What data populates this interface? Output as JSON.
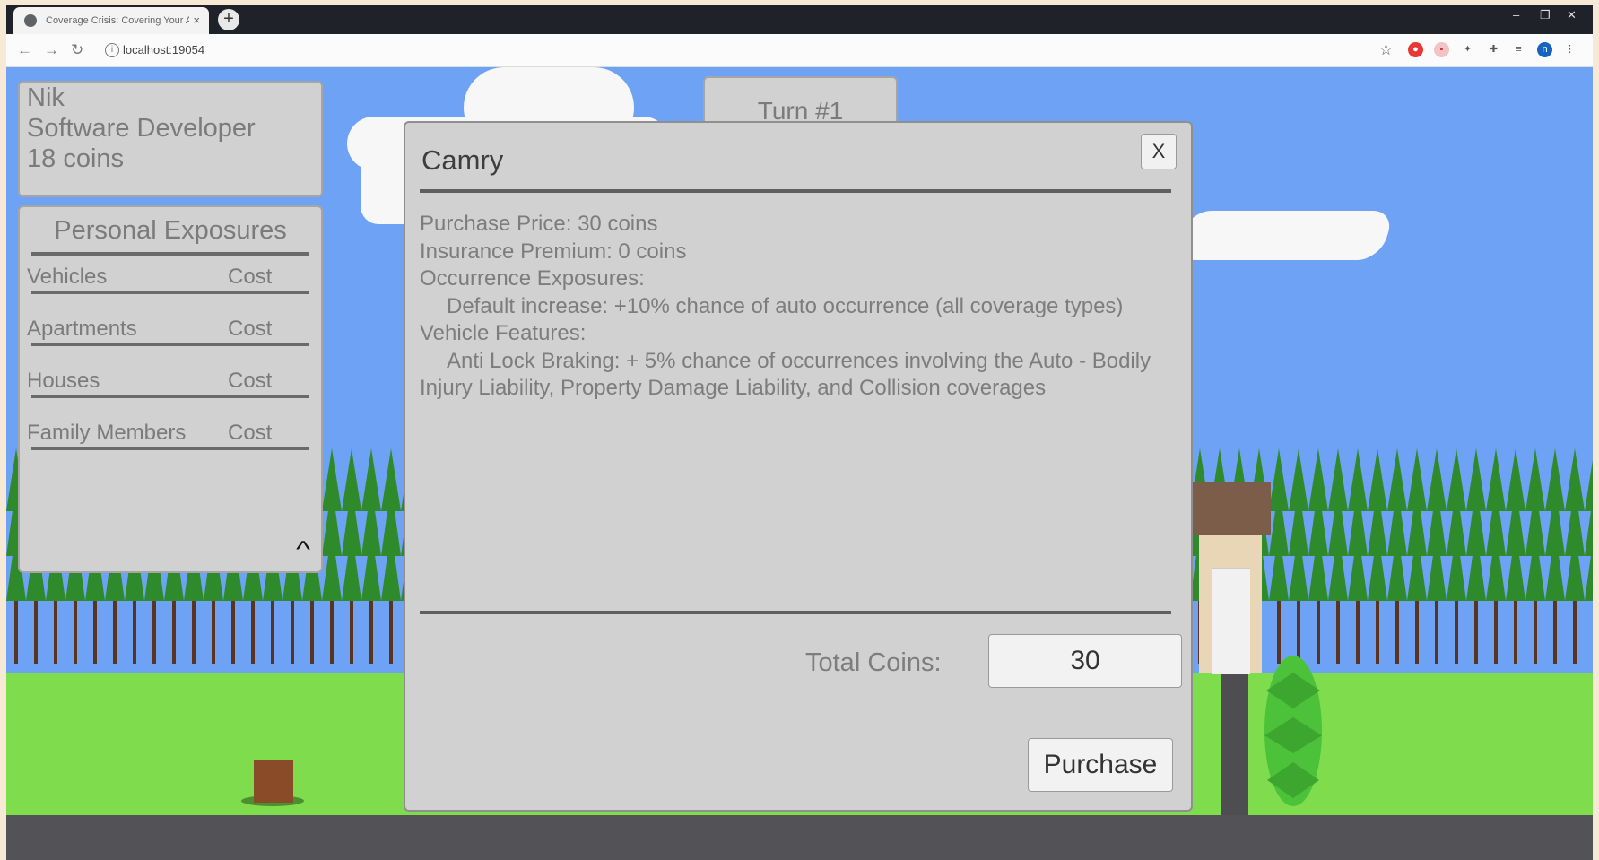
{
  "browser": {
    "tab_title": "Coverage Crisis: Covering Your A",
    "tab_close": "×",
    "new_tab": "+",
    "url": "localhost:19054",
    "window_controls": [
      "‒",
      "❐",
      "✕"
    ]
  },
  "player": {
    "name": "Nik",
    "occupation": "Software Developer",
    "coins": "18 coins"
  },
  "exposures": {
    "title": "Personal Exposures",
    "rows": [
      {
        "label": "Vehicles",
        "cost": "Cost"
      },
      {
        "label": "Apartments",
        "cost": "Cost"
      },
      {
        "label": "Houses",
        "cost": "Cost"
      },
      {
        "label": "Family Members",
        "cost": "Cost"
      }
    ],
    "collapse_icon": "^"
  },
  "turn": {
    "label": "Turn #1"
  },
  "modal": {
    "title": "Camry",
    "close": "X",
    "lines": [
      "Purchase Price: 30 coins",
      "Insurance Premium: 0 coins",
      "Occurrence Exposures:",
      "Default increase: +10% chance of auto occurrence (all coverage types)",
      "Vehicle Features:",
      "Anti Lock Braking: + 5% chance of occurrences involving the Auto - Bodily Injury Liability, Property Damage Liability, and Collision coverages"
    ],
    "total_label": "Total Coins:",
    "total_value": "30",
    "purchase_label": "Purchase"
  },
  "colors": {
    "sky": "#6ea2f4",
    "panel": "#d1d1d1",
    "grass": "#7fdc4d",
    "trees": "#2f8a2c",
    "road": "#535357"
  }
}
